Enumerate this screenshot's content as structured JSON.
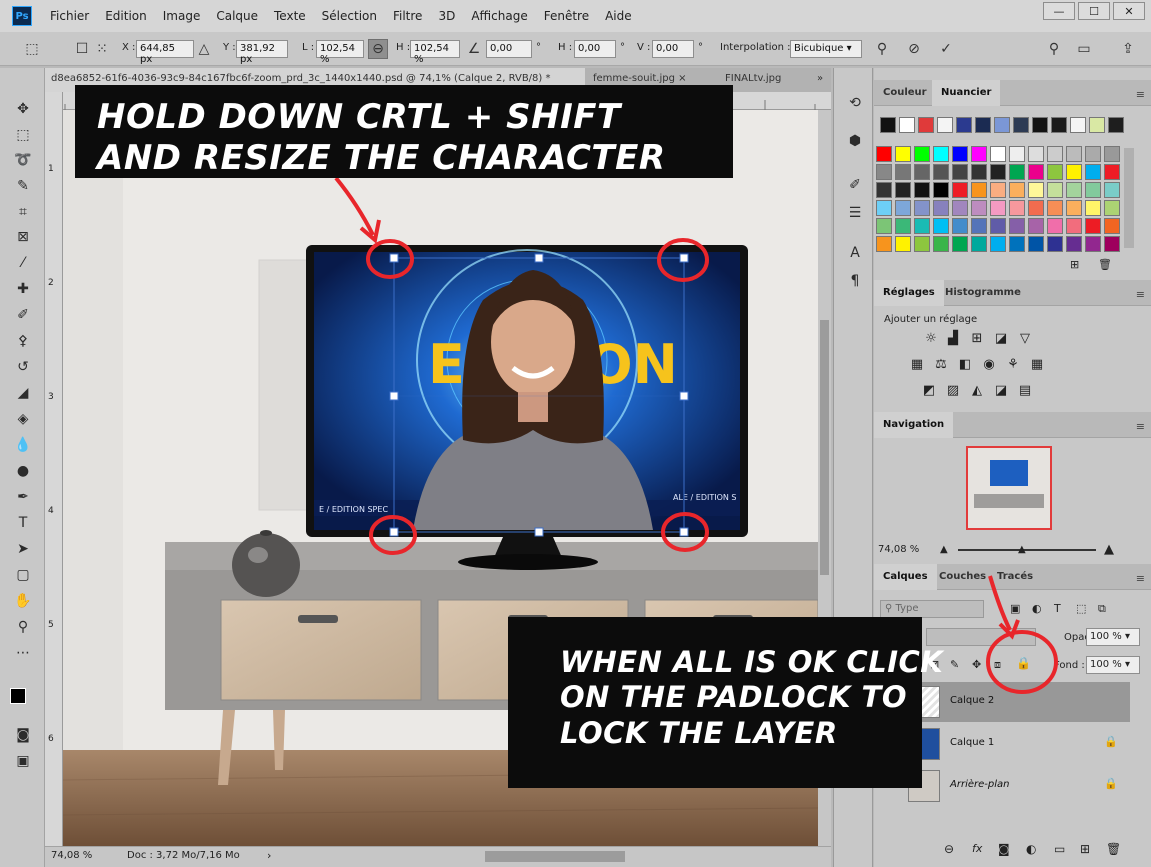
{
  "menubar": {
    "app_icon": "Ps",
    "items": [
      "Fichier",
      "Edition",
      "Image",
      "Calque",
      "Texte",
      "Sélection",
      "Filtre",
      "3D",
      "Affichage",
      "Fenêtre",
      "Aide"
    ],
    "window_controls": [
      "—",
      "☐",
      "✕"
    ]
  },
  "options": {
    "x_label": "X :",
    "x_value": "644,85 px",
    "y_label": "Y :",
    "y_value": "381,92 px",
    "w_label": "L :",
    "w_value": "102,54 %",
    "h_label": "H :",
    "h_value": "102,54 %",
    "angle_value": "0,00",
    "hskew_label": "H :",
    "hskew_value": "0,00",
    "vskew_label": "V :",
    "vskew_value": "0,00",
    "degree": "°",
    "interp_label": "Interpolation :",
    "interp_value": "Bicubique"
  },
  "tabs": [
    "d8ea6852-61f6-4036-93c9-84c167fbc6f-zoom_prd_3c_1440x1440.psd @ 74,1% (Calque 2, RVB/8) *",
    "femme-souit.jpg",
    "FINALtv.jpg"
  ],
  "tabs_close": "×",
  "tabs_more": "»",
  "ruler_top_labels": [
    "0",
    "1",
    "2",
    "3",
    "4",
    "5",
    "6"
  ],
  "ruler_left_labels": [
    "1",
    "2",
    "3",
    "4",
    "5",
    "6",
    "7",
    "8",
    "9",
    "1",
    "1",
    "2",
    "2",
    "3"
  ],
  "tv_text": {
    "edition": "EDITION",
    "ticker_left": "E / EDITION SPEC",
    "ticker_right": "ALE / EDITION S"
  },
  "status": {
    "zoom": "74,08 %",
    "doc": "Doc : 3,72 Mo/7,16 Mo",
    "arrow": "›"
  },
  "panels": {
    "color_tab": "Couleur",
    "swatches_tab": "Nuancier",
    "adjust_tab": "Réglages",
    "histogram_tab": "Histogramme",
    "adjust_hint": "Ajouter un réglage",
    "nav_tab": "Navigation",
    "nav_zoom": "74,08 %",
    "layers_tab": "Calques",
    "channels_tab": "Couches",
    "paths_tab": "Tracés",
    "filter_placeholder": "Type",
    "opacity_label": "Opacité :",
    "opacity_value": "100 %",
    "fill_label": "Fond :",
    "fill_value": "100 %",
    "menu_icon": "≡"
  },
  "layers": [
    {
      "name": "Calque 2",
      "locked": false,
      "selected": true
    },
    {
      "name": "Calque 1",
      "locked": true,
      "selected": false
    },
    {
      "name": "Arrière-plan",
      "locked": true,
      "selected": false
    }
  ],
  "swatch_colors_top": [
    "#111111",
    "#ffffff",
    "#e03a3a",
    "#f4f4f4",
    "#2b3a8f",
    "#1b2b52",
    "#7b97d6",
    "#2d3b54",
    "#121212",
    "#1a1a1a",
    "#f5f5f5",
    "#d9e8a4",
    "#1e1e1e"
  ],
  "swatch_colors_grid": [
    [
      "#ff0000",
      "#ffff00",
      "#00ff00",
      "#00ffff",
      "#0000ff",
      "#ff00ff",
      "#ffffff",
      "#eeeeee",
      "#dddddd",
      "#cccccc",
      "#bbbbbb",
      "#aaaaaa",
      "#999999"
    ],
    [
      "#888888",
      "#777777",
      "#666666",
      "#555555",
      "#444444",
      "#333333",
      "#222222",
      "#00a651",
      "#ec008c",
      "#8dc63f",
      "#fff200",
      "#00aeef",
      "#ee1c25"
    ],
    [
      "#333333",
      "#222222",
      "#111111",
      "#000000",
      "#ed1c24",
      "#f7941d",
      "#f9ad81",
      "#fbaf5d",
      "#fff799",
      "#c4df9b",
      "#a3d39c",
      "#82ca9c",
      "#7accc8"
    ],
    [
      "#6dcff6",
      "#7da7d9",
      "#8393ca",
      "#8781bd",
      "#a186be",
      "#bd8cbf",
      "#f49ac2",
      "#f6989d",
      "#f26c4f",
      "#f68e56",
      "#fbaf5d",
      "#fff568",
      "#acd373"
    ],
    [
      "#7cc576",
      "#3bb878",
      "#1abbb4",
      "#00bff3",
      "#438ccb",
      "#5574b9",
      "#605ca8",
      "#855fa8",
      "#a763a8",
      "#f06eaa",
      "#f26d7d",
      "#ed1c24",
      "#f26522"
    ],
    [
      "#f7941d",
      "#fff200",
      "#8dc63f",
      "#39b54a",
      "#00a651",
      "#00a99d",
      "#00aeef",
      "#0072bc",
      "#0054a6",
      "#2e3192",
      "#662d91",
      "#92278f",
      "#9e005d"
    ]
  ],
  "annotations": {
    "top_lines": [
      "HOLD DOWN CRTL + SHIFT",
      "AND RESIZE THE CHARACTER"
    ],
    "bottom_lines": [
      "WHEN ALL IS OK CLICK",
      "ON THE PADLOCK TO",
      "LOCK THE LAYER"
    ]
  },
  "annotation_color": "#e8262b"
}
